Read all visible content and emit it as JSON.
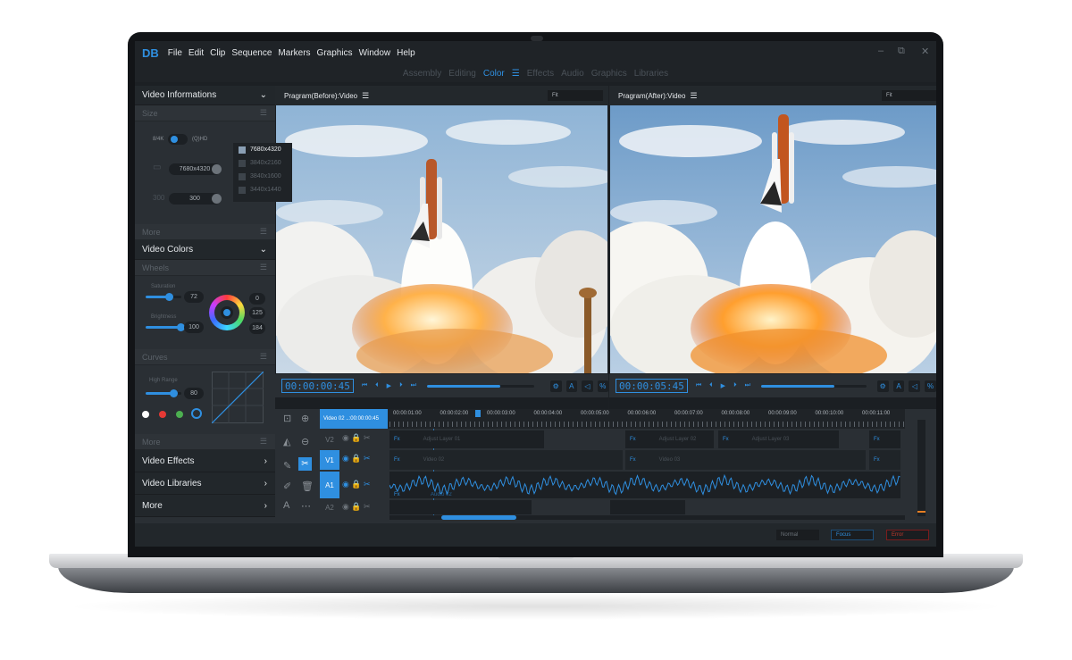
{
  "app": {
    "logo": "DB",
    "menu": [
      "File",
      "Edit",
      "Clip",
      "Sequence",
      "Markers",
      "Graphics",
      "Window",
      "Help"
    ],
    "window_controls": [
      "–",
      "⧉",
      "✕"
    ]
  },
  "workspace_tabs": [
    {
      "label": "Assembly",
      "active": false
    },
    {
      "label": "Editing",
      "active": false
    },
    {
      "label": "Color",
      "active": true
    },
    {
      "label": "Effects",
      "active": false
    },
    {
      "label": "Audio",
      "active": false
    },
    {
      "label": "Graphics",
      "active": false
    },
    {
      "label": "Libraries",
      "active": false
    }
  ],
  "sidebar": {
    "video_informations": "Video Informations",
    "size": "Size",
    "toggle_left": "8/4K",
    "toggle_right": "(Q)HD",
    "resolution": "7680x4320",
    "dpi_label": "DPI",
    "dpi_value": "300",
    "resolution_options": [
      "7680x4320",
      "3840x2160",
      "3840x1600",
      "3440x1440"
    ],
    "more_1": "More",
    "video_colors": "Video Colors",
    "wheels": "Wheels",
    "saturation_label": "Saturation",
    "saturation_value": "72",
    "brightness_label": "Brightness",
    "brightness_value": "100",
    "rgb_values": [
      "0",
      "125",
      "184"
    ],
    "curves": "Curves",
    "high_range_label": "High Range",
    "high_range_value": "80",
    "more_2": "More",
    "video_effects": "Video Effects",
    "video_libraries": "Video Libraries",
    "more_3": "More"
  },
  "viewer_before": {
    "title": "Pragram(Before):Video",
    "fit": "Fit",
    "timecode": "00:00:00:45",
    "progress": 0.68
  },
  "viewer_after": {
    "title": "Pragram(After):Video",
    "fit": "Fit",
    "timecode": "00:00:05:45",
    "progress": 0.7
  },
  "timeline": {
    "sequence": "Video 02 ..:00:00:00:45",
    "ticks": [
      "00:00:01:00",
      "00:00:02:00",
      "00:00:03:00",
      "00:00:04:00",
      "00:00:05:00",
      "00:00:06:00",
      "00:00:07:00",
      "00:00:08:00",
      "00:00:09:00",
      "00:00:10:00",
      "00:00:11:00"
    ],
    "tracks": [
      "V2",
      "V1",
      "A1",
      "A2"
    ],
    "fx": "Fx",
    "clips_v2": [
      "Adjust Layer 01",
      "Adjust Layer 02",
      "Adjust Layer 03"
    ],
    "clips_v1": [
      "Video 02",
      "Video 03"
    ],
    "clips_a1": "Audio 02"
  },
  "status": {
    "normal": "Normal",
    "focus": "Focus",
    "error": "Error"
  },
  "colors": {
    "accent": "#2f8fe0",
    "error": "#c0392b"
  }
}
